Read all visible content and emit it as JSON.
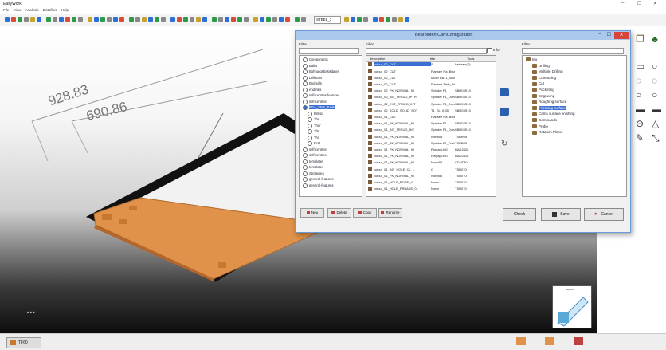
{
  "app": {
    "title": "EasyWork",
    "window_controls": [
      "–",
      "☐",
      "✕"
    ]
  },
  "menu": [
    "File",
    "View",
    "Analysis",
    "Datafiles",
    "Help"
  ],
  "toolbar": {
    "dropdown_value": "STEEL_1"
  },
  "viewport": {
    "dims": [
      "928.83",
      "690.86"
    ]
  },
  "dialog": {
    "title": "Bearbeiten CamConfiguration",
    "filter_label": "Filter",
    "middle_filter_label": "Filter",
    "right_filter_label": "Filter",
    "checkbox_label": "Info",
    "left_tree": [
      {
        "label": "Components",
        "sel": false
      },
      {
        "label": "Ballnr",
        "sel": false
      },
      {
        "label": "Bohrungsbasisdaten",
        "sel": false
      },
      {
        "label": "Drillsubs",
        "sel": false
      },
      {
        "label": "Endmills",
        "sel": false
      },
      {
        "label": "endmills",
        "sel": false
      },
      {
        "label": "self-centres-features",
        "sel": false
      },
      {
        "label": "self-centres",
        "sel": false
      },
      {
        "label": "PGA_SBR_Tools",
        "sel": true
      },
      {
        "label": "Drillsd",
        "sel": false
      },
      {
        "label": "Tbs",
        "sel": false
      },
      {
        "label": "Thdr",
        "sel": false
      },
      {
        "label": "Tfm",
        "sel": false
      },
      {
        "label": "Thit",
        "sel": false
      },
      {
        "label": "Ecst",
        "sel": false
      },
      {
        "label": "self-centres",
        "sel": false
      },
      {
        "label": "self-centres",
        "sel": false
      },
      {
        "label": "templates",
        "sel": false
      },
      {
        "label": "templates",
        "sel": false
      },
      {
        "label": "Strategies",
        "sel": false
      },
      {
        "label": "general-features",
        "sel": false
      },
      {
        "label": "general-features",
        "sel": false
      }
    ],
    "list_headers": [
      "description",
      "title",
      "Tools"
    ],
    "list_rows": [
      {
        "c1": "cutout_02_CUT",
        "c2": "S",
        "c3": "Laterals(S)",
        "sel": true
      },
      {
        "c1": "cutout_02_CUT",
        "c2": "Flansee Ra. Bsta...",
        "c3": "",
        "sel": false
      },
      {
        "c1": "cutout_02_CUT",
        "c2": "Micro Ra. 1_Sbo...",
        "c3": "",
        "sel": false
      },
      {
        "c1": "cutout_02_CUT",
        "c2": "Flansee Tiefs_Bst...",
        "c3": "",
        "sel": false
      },
      {
        "c1": "cutout_02_PK_NORMAL_90",
        "c2": "Spinder F1",
        "c3": "SBR03S10",
        "sel": false
      },
      {
        "c1": "cutout_02_INT_TRSUG_IPTR",
        "c2": "Spinder F1_Durv",
        "c3": "SBR03S10",
        "sel": false
      },
      {
        "c1": "cutout_02_EXT_TRSUG_INT",
        "c2": "Spinder F1_Durv",
        "c3": "SBR03S10",
        "sel": false
      },
      {
        "c1": "cutout_02_SOLD_SOLID_SOT",
        "c2": "T1_SL_0.35",
        "c3": "SBR03S10",
        "sel": false
      },
      {
        "c1": "cutout_01_CUT",
        "c2": "Flansee Ra. Bsta...",
        "c3": "",
        "sel": false
      },
      {
        "c1": "cutout_01_PK_NORMAL_90",
        "c2": "Spinder F1",
        "c3": "SBR03S10",
        "sel": false
      },
      {
        "c1": "cutout_01_INT_TRSUG_INT",
        "c2": "Spinder F1_Durv",
        "c3": "SBR03S10",
        "sel": false
      },
      {
        "c1": "cutout_01_PK_NORMAL_90",
        "c2": "Norm55",
        "c3": "TSBR05",
        "sel": false
      },
      {
        "c1": "cutout_01_PK_NORMAL_90",
        "c2": "Spinder F1_Durv",
        "c3": "TSBR05",
        "sel": false
      },
      {
        "c1": "cutout_01_PK_NORMAL_90",
        "c2": "Ringapt-KG",
        "c3": "RAD2828",
        "sel": false
      },
      {
        "c1": "cutout_01_PK_NORMAL_90",
        "c2": "Ringapt-KG",
        "c3": "RAD2828",
        "sel": false
      },
      {
        "c1": "cutout_01_PK_NORMAL_90",
        "c2": "Norm55",
        "c3": "CDNT30",
        "sel": false
      },
      {
        "c1": "cutout_01_INT_HOLE_CL_...",
        "c2": "G",
        "c3": "TSR070",
        "sel": false
      },
      {
        "c1": "cutout_01_PK_NORMAL_90",
        "c2": "Norm55",
        "c3": "TSR070",
        "sel": false
      },
      {
        "c1": "cutout_01_HOLE_BORE_4",
        "c2": "Norm",
        "c3": "TSR070",
        "sel": false
      },
      {
        "c1": "cutout_01_HOLE_PRBASE_01",
        "c2": "Norm",
        "c3": "TSR070",
        "sel": false
      }
    ],
    "right_tree": [
      {
        "label": "Mo",
        "sel": false,
        "level": 0
      },
      {
        "label": "Drilling",
        "sel": false,
        "level": 1
      },
      {
        "label": "Multiple Drilling",
        "sel": false,
        "level": 1
      },
      {
        "label": "Contouring",
        "sel": false,
        "level": 1
      },
      {
        "label": "Cut",
        "sel": false,
        "level": 1
      },
      {
        "label": "Pocketing",
        "sel": false,
        "level": 1
      },
      {
        "label": "Engraving",
        "sel": false,
        "level": 1
      },
      {
        "label": "Roughing surface",
        "sel": false,
        "level": 1
      },
      {
        "label": "Finishing surface",
        "sel": true,
        "level": 1
      },
      {
        "label": "Cams surface finishing",
        "sel": false,
        "level": 1
      },
      {
        "label": "Commands",
        "sel": false,
        "level": 1
      },
      {
        "label": "Probe",
        "sel": false,
        "level": 1
      },
      {
        "label": "Rotation Plane",
        "sel": false,
        "level": 1
      }
    ],
    "bottom_buttons": [
      {
        "label": "Neu",
        "icon": "new-icon"
      },
      {
        "label": "Delete",
        "icon": "delete-icon"
      },
      {
        "label": "Copy",
        "icon": "copy-icon"
      },
      {
        "label": "Rename",
        "icon": "rename-icon"
      }
    ],
    "check_button": "Check",
    "save_button": "Save",
    "cancel_button": "Cancel"
  },
  "minimap": {
    "label": "Layer"
  },
  "status": {
    "button_label": "TF60"
  },
  "colors": {
    "part_orange": "#e0924a",
    "dialog_title": "#a9c8ec",
    "selection": "#3a6fd1",
    "close_red": "#d9443a"
  }
}
